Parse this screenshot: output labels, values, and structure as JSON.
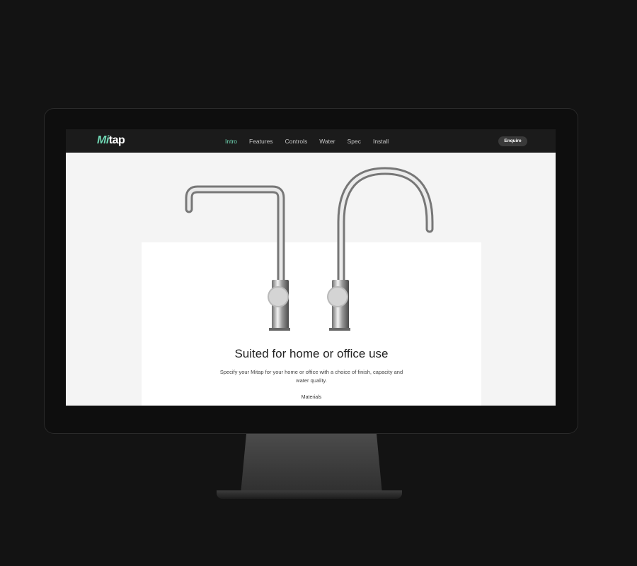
{
  "brand": {
    "logo_prefix": "Mi",
    "logo_suffix": "tap",
    "accent": "#6fd6b3"
  },
  "nav": {
    "items": [
      "Intro",
      "Features",
      "Controls",
      "Water",
      "Spec",
      "Install"
    ],
    "active": "Intro",
    "cta_label": "Enquire"
  },
  "hero": {
    "headline": "Suited for home or office use",
    "subtext": "Specify your Mitap for your home or office with a choice of finish, capacity and water quality.",
    "section_link": "Materials"
  }
}
